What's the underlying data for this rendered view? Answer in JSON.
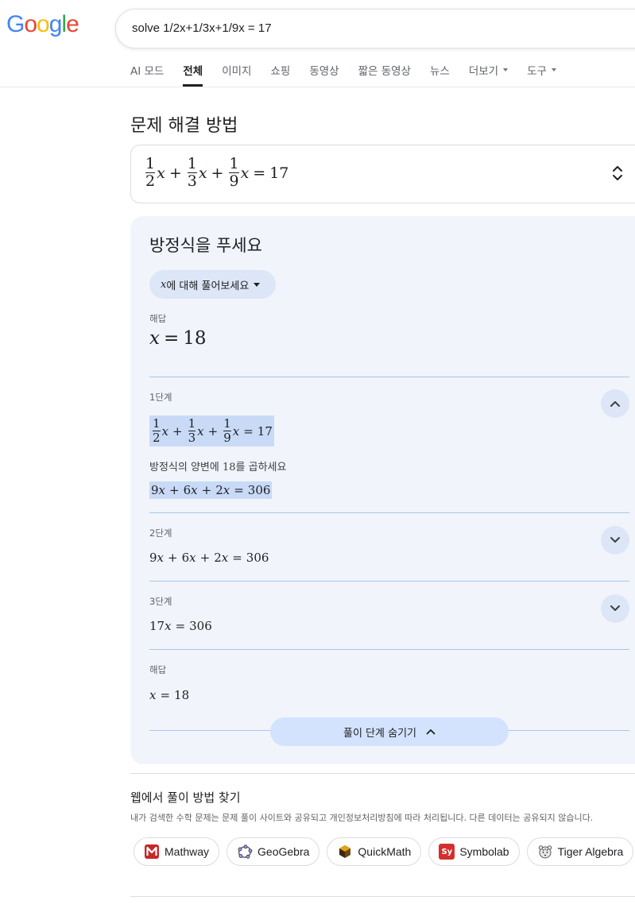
{
  "logo": {
    "letters": [
      "G",
      "o",
      "o",
      "g",
      "l",
      "e"
    ],
    "colors": [
      "#4285F4",
      "#EA4335",
      "#FBBC05",
      "#4285F4",
      "#34A853",
      "#EA4335"
    ]
  },
  "search": {
    "query": "solve 1/2x+1/3x+1/9x = 17"
  },
  "tabs": [
    {
      "label": "AI 모드",
      "active": false,
      "dropdown": false
    },
    {
      "label": "전체",
      "active": true,
      "dropdown": false
    },
    {
      "label": "이미지",
      "active": false,
      "dropdown": false
    },
    {
      "label": "쇼핑",
      "active": false,
      "dropdown": false
    },
    {
      "label": "동영상",
      "active": false,
      "dropdown": false
    },
    {
      "label": "짧은 동영상",
      "active": false,
      "dropdown": false
    },
    {
      "label": "뉴스",
      "active": false,
      "dropdown": false
    },
    {
      "label": "더보기",
      "active": false,
      "dropdown": true
    },
    {
      "label": "도구",
      "active": false,
      "dropdown": true
    }
  ],
  "problem": {
    "title": "문제 해결 방법",
    "equation": {
      "fractions": [
        [
          "1",
          "2"
        ],
        [
          "1",
          "3"
        ],
        [
          "1",
          "9"
        ]
      ],
      "var": "x",
      "plus": "+",
      "eq": "=",
      "rhs": "17"
    }
  },
  "card": {
    "title": "방정식을 푸세요",
    "solve_for_var": "x",
    "solve_for_label": "에 대해 풀어보세요",
    "answer_label": "해답",
    "answer": {
      "var": "x",
      "eq": "=",
      "value": "18"
    },
    "steps": [
      {
        "label": "1단계",
        "expanded": true,
        "instruction_prefix": "방정식의 양변에 ",
        "instruction_value": "18",
        "instruction_suffix": "를 곱하세요",
        "result": {
          "coefs": [
            "9",
            "6",
            "2"
          ],
          "rhs": "306"
        }
      },
      {
        "label": "2단계",
        "expanded": false,
        "result": {
          "coefs": [
            "9",
            "6",
            "2"
          ],
          "rhs": "306"
        }
      },
      {
        "label": "3단계",
        "expanded": false,
        "result": {
          "coef": "17",
          "rhs": "306"
        }
      }
    ],
    "final_label": "해답",
    "final": {
      "var": "x",
      "eq": "=",
      "value": "18"
    },
    "hide_steps_label": "풀이 단계 숨기기"
  },
  "web": {
    "title": "웹에서 풀이 방법 찾기",
    "description": "내가 검색한 수학 문제는 문제 풀이 사이트와 공유되고 개인정보처리방침에 따라 처리됩니다. 다른 데이터는 공유되지 않습니다.",
    "sources": [
      {
        "label": "Mathway",
        "icon": "mathway-icon"
      },
      {
        "label": "GeoGebra",
        "icon": "geogebra-icon"
      },
      {
        "label": "QuickMath",
        "icon": "quickmath-icon"
      },
      {
        "label": "Symbolab",
        "icon": "symbolab-icon",
        "icon_text": "Sy"
      },
      {
        "label": "Tiger Algebra",
        "icon": "tiger-algebra-icon"
      }
    ]
  }
}
